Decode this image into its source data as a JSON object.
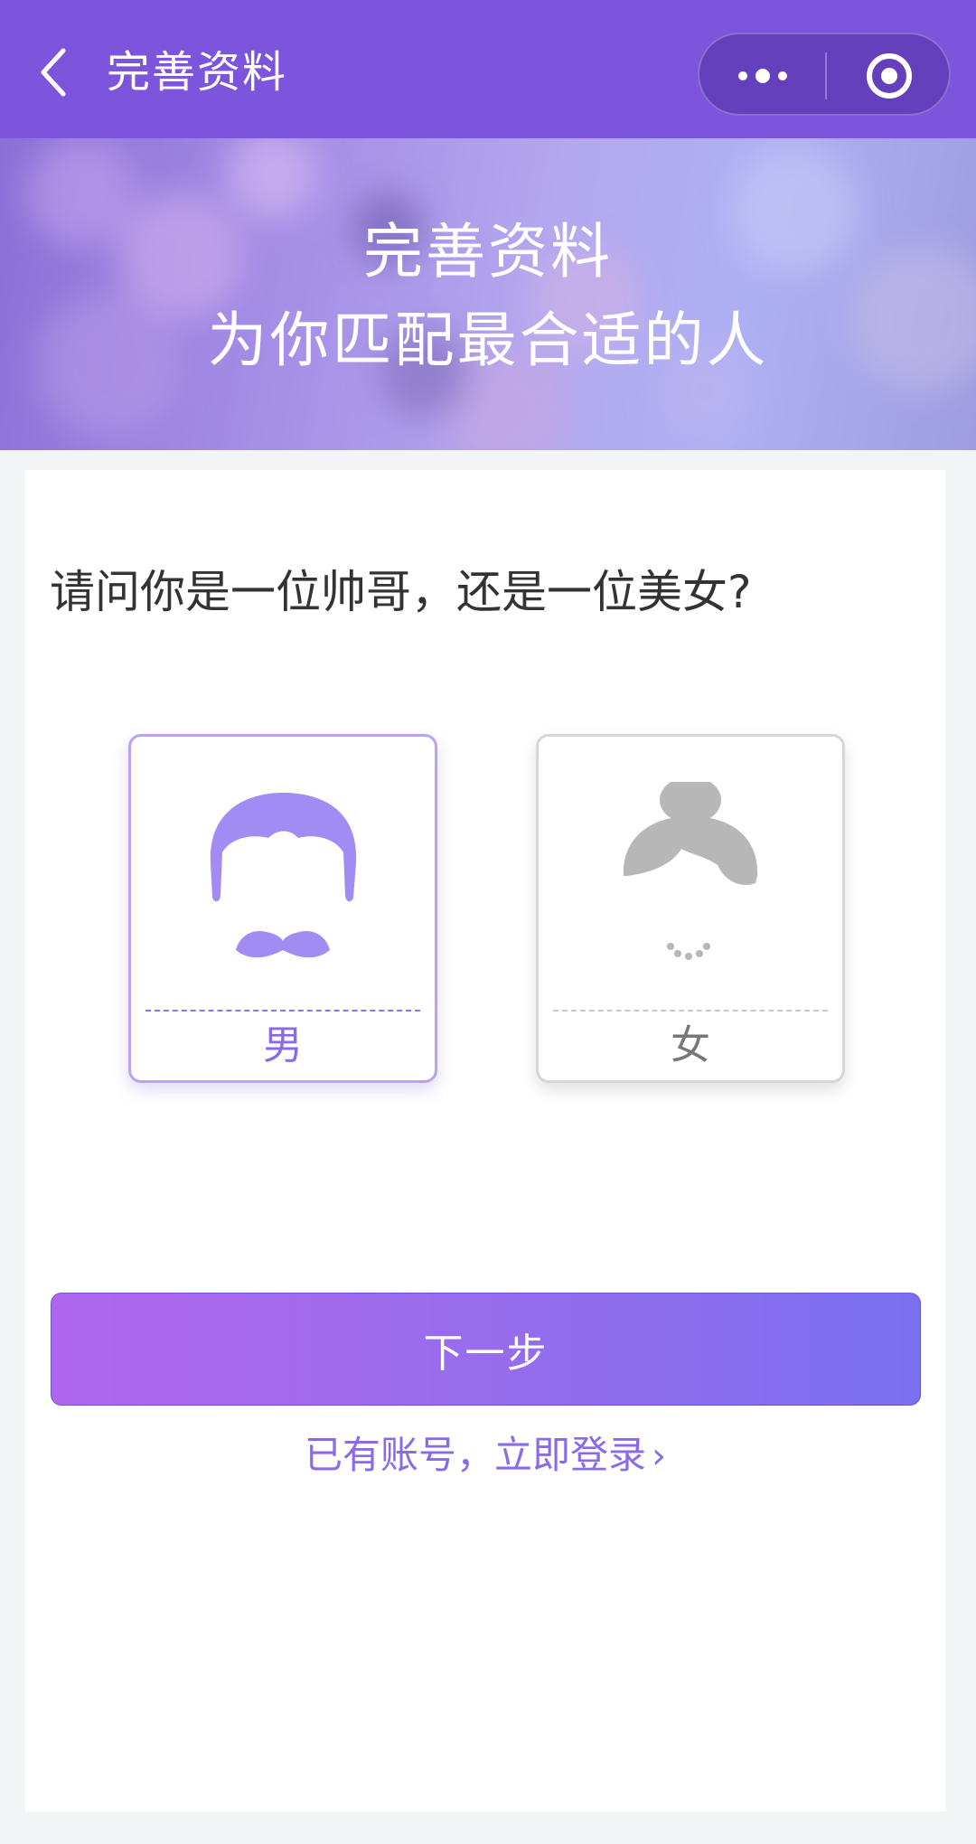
{
  "header": {
    "title": "完善资料",
    "back_icon": "chevron-left-icon",
    "more_icon": "more-dots-icon",
    "target_icon": "target-icon",
    "background_color": "#7d55dd"
  },
  "banner": {
    "line1": "完善资料",
    "line2": "为你匹配最合适的人"
  },
  "question": "请问你是一位帅哥，还是一位美女?",
  "gender_options": [
    {
      "label": "男",
      "icon": "male-avatar-icon",
      "selected": true,
      "color": "#a08cf3"
    },
    {
      "label": "女",
      "icon": "female-avatar-icon",
      "selected": false,
      "color": "#b7b7b7"
    }
  ],
  "next_button": "下一步",
  "login_link": "已有账号，立即登录",
  "accent_color": "#8a6ae6"
}
